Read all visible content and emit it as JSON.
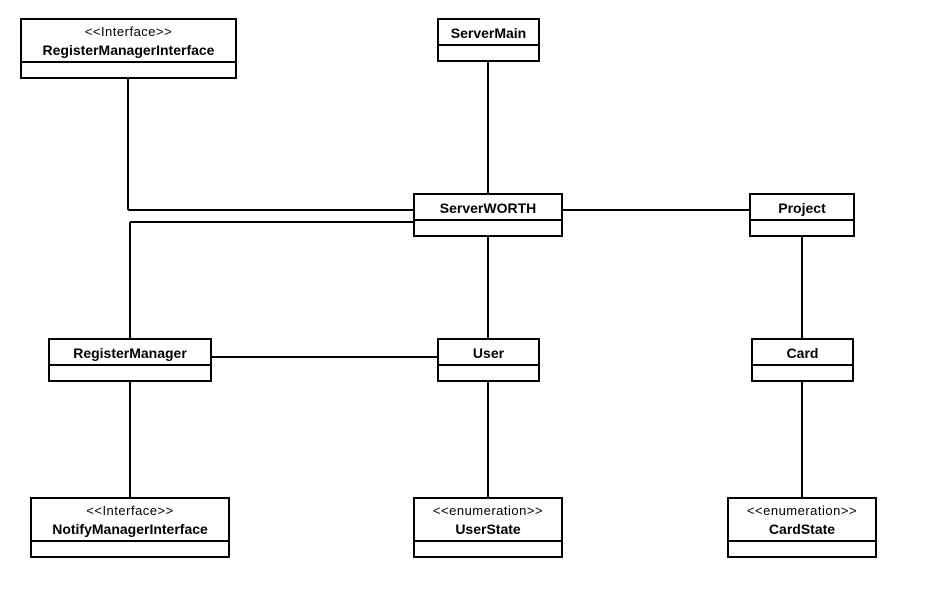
{
  "nodes": {
    "registerManagerInterface": {
      "stereotype": "<<Interface>>",
      "name": "RegisterManagerInterface"
    },
    "serverMain": {
      "name": "ServerMain"
    },
    "serverWorth": {
      "name": "ServerWORTH"
    },
    "project": {
      "name": "Project"
    },
    "registerManager": {
      "name": "RegisterManager"
    },
    "user": {
      "name": "User"
    },
    "card": {
      "name": "Card"
    },
    "notifyManagerInterface": {
      "stereotype": "<<Interface>>",
      "name": "NotifyManagerInterface"
    },
    "userState": {
      "stereotype": "<<enumeration>>",
      "name": "UserState"
    },
    "cardState": {
      "stereotype": "<<enumeration>>",
      "name": "CardState"
    }
  },
  "chart_data": {
    "type": "uml-class-diagram",
    "classes": [
      {
        "id": "RegisterManagerInterface",
        "stereotype": "Interface"
      },
      {
        "id": "ServerMain"
      },
      {
        "id": "ServerWORTH"
      },
      {
        "id": "Project"
      },
      {
        "id": "RegisterManager"
      },
      {
        "id": "User"
      },
      {
        "id": "Card"
      },
      {
        "id": "NotifyManagerInterface",
        "stereotype": "Interface"
      },
      {
        "id": "UserState",
        "stereotype": "enumeration"
      },
      {
        "id": "CardState",
        "stereotype": "enumeration"
      }
    ],
    "associations": [
      [
        "RegisterManagerInterface",
        "ServerWORTH"
      ],
      [
        "ServerMain",
        "ServerWORTH"
      ],
      [
        "ServerWORTH",
        "Project"
      ],
      [
        "ServerWORTH",
        "RegisterManager"
      ],
      [
        "ServerWORTH",
        "User"
      ],
      [
        "Project",
        "Card"
      ],
      [
        "RegisterManager",
        "User"
      ],
      [
        "RegisterManager",
        "NotifyManagerInterface"
      ],
      [
        "User",
        "UserState"
      ],
      [
        "Card",
        "CardState"
      ]
    ]
  }
}
